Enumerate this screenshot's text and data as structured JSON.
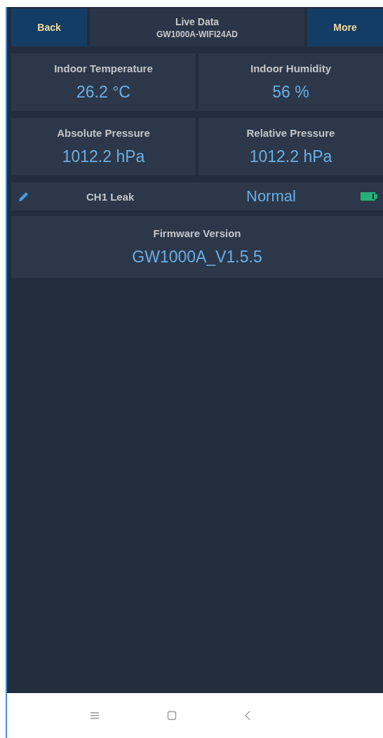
{
  "header": {
    "back": "Back",
    "title": "Live Data",
    "subtitle": "GW1000A-WIFI24AD",
    "more": "More"
  },
  "readings": [
    {
      "label": "Indoor Temperature",
      "value": "26.2 °C"
    },
    {
      "label": "Indoor Humidity",
      "value": "56 %"
    },
    {
      "label": "Absolute Pressure",
      "value": "1012.2 hPa"
    },
    {
      "label": "Relative Pressure",
      "value": "1012.2 hPa"
    }
  ],
  "sensors": [
    {
      "name": "CH1 Leak",
      "status": "Normal"
    }
  ],
  "firmware": {
    "label": "Firmware Version",
    "value": "GW1000A_V1.5.5"
  }
}
